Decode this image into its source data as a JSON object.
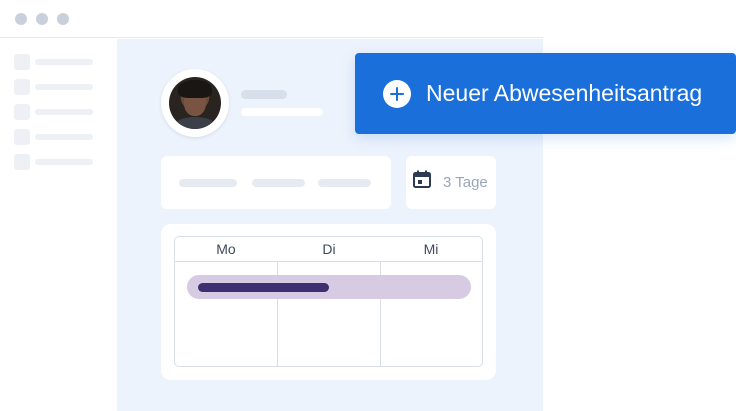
{
  "colors": {
    "accent": "#1a6fdb",
    "main_background": "#edf3fc",
    "bar_track": "#d6cbe3",
    "bar_fill": "#3d2f70"
  },
  "header": {
    "window_controls": [
      "dot",
      "dot",
      "dot"
    ]
  },
  "profile": {
    "avatar_icon": "user-avatar"
  },
  "duration": {
    "icon": "calendar-icon",
    "label": "3 Tage"
  },
  "calendar": {
    "columns": [
      "Mo",
      "Di",
      "Mi"
    ],
    "absence_progress": 0.5
  },
  "cta": {
    "icon": "plus-circle-icon",
    "label": "Neuer Abwesenheitsantrag"
  }
}
